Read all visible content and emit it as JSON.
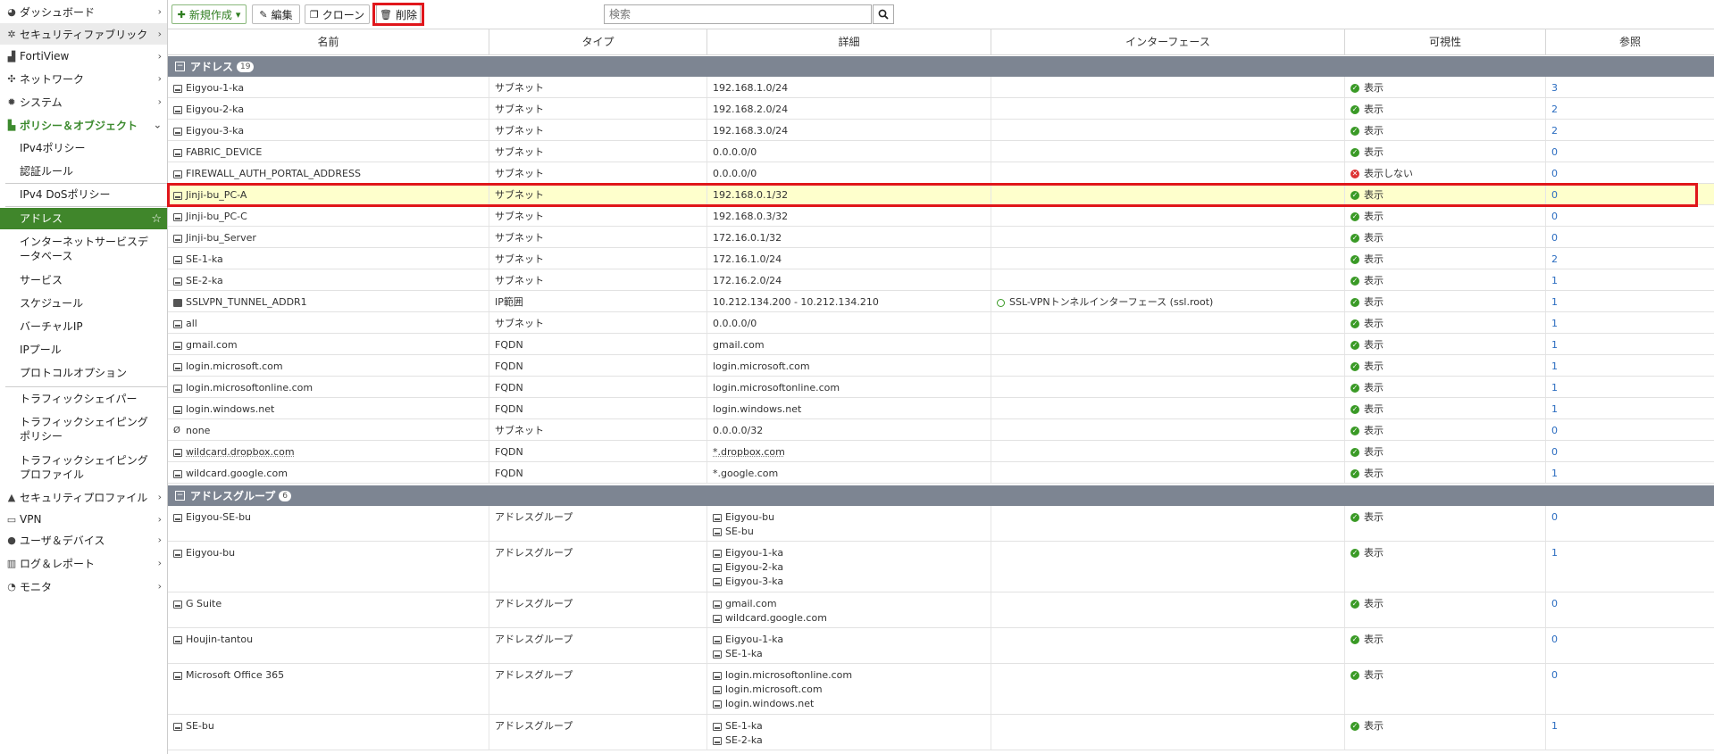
{
  "sidebar": {
    "items": [
      {
        "label": "ダッシュボード",
        "icon": "dashboard-icon"
      },
      {
        "label": "セキュリティファブリック",
        "icon": "fabric-icon"
      },
      {
        "label": "FortiView",
        "icon": "chart-icon"
      },
      {
        "label": "ネットワーク",
        "icon": "network-icon"
      },
      {
        "label": "システム",
        "icon": "gear-icon"
      },
      {
        "label": "ポリシー＆オブジェクト",
        "icon": "policy-icon"
      },
      {
        "label": "IPv4ポリシー"
      },
      {
        "label": "認証ルール"
      },
      {
        "label": "IPv4 DoSポリシー"
      },
      {
        "label": "アドレス"
      },
      {
        "label": "インターネットサービスデータベース"
      },
      {
        "label": "サービス"
      },
      {
        "label": "スケジュール"
      },
      {
        "label": "バーチャルIP"
      },
      {
        "label": "IPプール"
      },
      {
        "label": "プロトコルオプション"
      },
      {
        "label": "トラフィックシェイパー"
      },
      {
        "label": "トラフィックシェイピングポリシー"
      },
      {
        "label": "トラフィックシェイピングプロファイル"
      },
      {
        "label": "セキュリティプロファイル",
        "icon": "lock-icon"
      },
      {
        "label": "VPN",
        "icon": "vpn-icon"
      },
      {
        "label": "ユーザ＆デバイス",
        "icon": "user-icon"
      },
      {
        "label": "ログ＆レポート",
        "icon": "report-icon"
      },
      {
        "label": "モニタ",
        "icon": "monitor-icon"
      }
    ]
  },
  "toolbar": {
    "new_label": "新規作成",
    "edit_label": "編集",
    "clone_label": "クローン",
    "delete_label": "削除",
    "search_placeholder": "検索"
  },
  "columns": [
    "名前",
    "タイプ",
    "詳細",
    "インターフェース",
    "可視性",
    "参照"
  ],
  "groups": [
    {
      "label": "アドレス",
      "count": "19"
    },
    {
      "label": "アドレスグループ",
      "count": "6"
    }
  ],
  "addresses": [
    {
      "name": "Eigyou-1-ka",
      "type": "サブネット",
      "detail": "192.168.1.0/24",
      "interface": "",
      "visibility": "表示",
      "ref": "3"
    },
    {
      "name": "Eigyou-2-ka",
      "type": "サブネット",
      "detail": "192.168.2.0/24",
      "interface": "",
      "visibility": "表示",
      "ref": "2"
    },
    {
      "name": "Eigyou-3-ka",
      "type": "サブネット",
      "detail": "192.168.3.0/24",
      "interface": "",
      "visibility": "表示",
      "ref": "2"
    },
    {
      "name": "FABRIC_DEVICE",
      "type": "サブネット",
      "detail": "0.0.0.0/0",
      "interface": "",
      "visibility": "表示",
      "ref": "0"
    },
    {
      "name": "FIREWALL_AUTH_PORTAL_ADDRESS",
      "type": "サブネット",
      "detail": "0.0.0.0/0",
      "interface": "",
      "visibility": "表示しない",
      "ref": "0"
    },
    {
      "name": "Jinji-bu_PC-A",
      "type": "サブネット",
      "detail": "192.168.0.1/32",
      "interface": "",
      "visibility": "表示",
      "ref": "0"
    },
    {
      "name": "Jinji-bu_PC-C",
      "type": "サブネット",
      "detail": "192.168.0.3/32",
      "interface": "",
      "visibility": "表示",
      "ref": "0"
    },
    {
      "name": "Jinji-bu_Server",
      "type": "サブネット",
      "detail": "172.16.0.1/32",
      "interface": "",
      "visibility": "表示",
      "ref": "0"
    },
    {
      "name": "SE-1-ka",
      "type": "サブネット",
      "detail": "172.16.1.0/24",
      "interface": "",
      "visibility": "表示",
      "ref": "2"
    },
    {
      "name": "SE-2-ka",
      "type": "サブネット",
      "detail": "172.16.2.0/24",
      "interface": "",
      "visibility": "表示",
      "ref": "1"
    },
    {
      "name": "SSLVPN_TUNNEL_ADDR1",
      "type": "IP範囲",
      "detail": "10.212.134.200 - 10.212.134.210",
      "interface": "SSL-VPNトンネルインターフェース (ssl.root)",
      "visibility": "表示",
      "ref": "1"
    },
    {
      "name": "all",
      "type": "サブネット",
      "detail": "0.0.0.0/0",
      "interface": "",
      "visibility": "表示",
      "ref": "1"
    },
    {
      "name": "gmail.com",
      "type": "FQDN",
      "detail": "gmail.com",
      "interface": "",
      "visibility": "表示",
      "ref": "1"
    },
    {
      "name": "login.microsoft.com",
      "type": "FQDN",
      "detail": "login.microsoft.com",
      "interface": "",
      "visibility": "表示",
      "ref": "1"
    },
    {
      "name": "login.microsoftonline.com",
      "type": "FQDN",
      "detail": "login.microsoftonline.com",
      "interface": "",
      "visibility": "表示",
      "ref": "1"
    },
    {
      "name": "login.windows.net",
      "type": "FQDN",
      "detail": "login.windows.net",
      "interface": "",
      "visibility": "表示",
      "ref": "1"
    },
    {
      "name": "none",
      "type": "サブネット",
      "detail": "0.0.0.0/32",
      "interface": "",
      "visibility": "表示",
      "ref": "0"
    },
    {
      "name": "wildcard.dropbox.com",
      "type": "FQDN",
      "detail": "*.dropbox.com",
      "interface": "",
      "visibility": "表示",
      "ref": "0"
    },
    {
      "name": "wildcard.google.com",
      "type": "FQDN",
      "detail": "*.google.com",
      "interface": "",
      "visibility": "表示",
      "ref": "1"
    }
  ],
  "address_groups": [
    {
      "name": "Eigyou-SE-bu",
      "type": "アドレスグループ",
      "members": [
        "Eigyou-bu",
        "SE-bu"
      ],
      "visibility": "表示",
      "ref": "0"
    },
    {
      "name": "Eigyou-bu",
      "type": "アドレスグループ",
      "members": [
        "Eigyou-1-ka",
        "Eigyou-2-ka",
        "Eigyou-3-ka"
      ],
      "visibility": "表示",
      "ref": "1"
    },
    {
      "name": "G Suite",
      "type": "アドレスグループ",
      "members": [
        "gmail.com",
        "wildcard.google.com"
      ],
      "visibility": "表示",
      "ref": "0"
    },
    {
      "name": "Houjin-tantou",
      "type": "アドレスグループ",
      "members": [
        "Eigyou-1-ka",
        "SE-1-ka"
      ],
      "visibility": "表示",
      "ref": "0"
    },
    {
      "name": "Microsoft Office 365",
      "type": "アドレスグループ",
      "members": [
        "login.microsoftonline.com",
        "login.microsoft.com",
        "login.windows.net"
      ],
      "visibility": "表示",
      "ref": "0"
    },
    {
      "name": "SE-bu",
      "type": "アドレスグループ",
      "members": [
        "SE-1-ka",
        "SE-2-ka"
      ],
      "visibility": "表示",
      "ref": "1"
    }
  ]
}
